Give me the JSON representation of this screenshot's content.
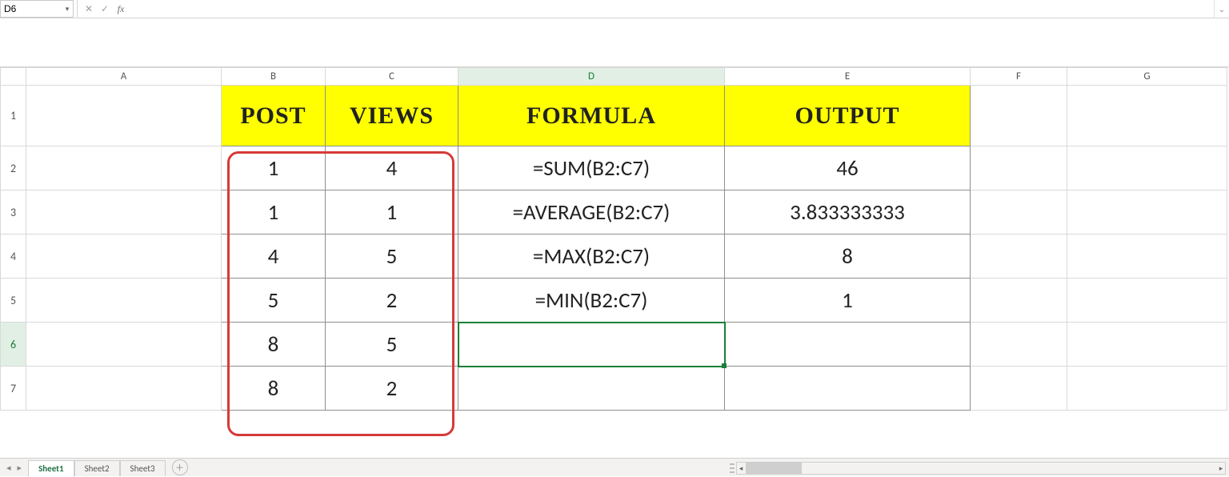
{
  "namebox": "D6",
  "fx_label": "fx",
  "columns": [
    "A",
    "B",
    "C",
    "D",
    "E",
    "F",
    "G"
  ],
  "rows": [
    "1",
    "2",
    "3",
    "4",
    "5",
    "6",
    "7"
  ],
  "headers": {
    "B": "POST",
    "C": "VIEWS",
    "D": "FORMULA",
    "E": "OUTPUT"
  },
  "data": {
    "r2": {
      "B": "1",
      "C": "4",
      "D": "=SUM(B2:C7)",
      "E": "46"
    },
    "r3": {
      "B": "1",
      "C": "1",
      "D": "=AVERAGE(B2:C7)",
      "E": "3.833333333"
    },
    "r4": {
      "B": "4",
      "C": "5",
      "D": "=MAX(B2:C7)",
      "E": "8"
    },
    "r5": {
      "B": "5",
      "C": "2",
      "D": "=MIN(B2:C7)",
      "E": "1"
    },
    "r6": {
      "B": "8",
      "C": "5"
    },
    "r7": {
      "B": "8",
      "C": "2"
    }
  },
  "tabs": [
    "Sheet1",
    "Sheet2",
    "Sheet3"
  ],
  "active_tab": "Sheet1",
  "formula_value": ""
}
